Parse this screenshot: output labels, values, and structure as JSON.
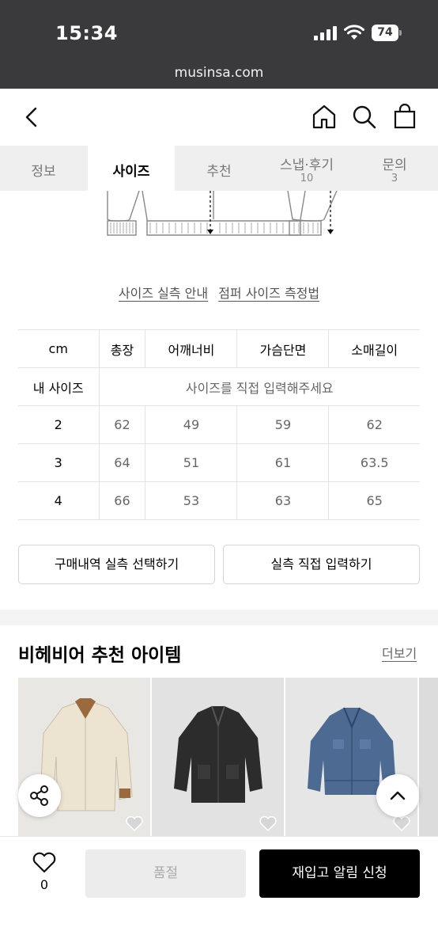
{
  "status_bar": {
    "time": "15:34",
    "battery": "74"
  },
  "browser": {
    "url": "musinsa.com"
  },
  "tabs": [
    {
      "label": "정보",
      "count": ""
    },
    {
      "label": "사이즈",
      "count": ""
    },
    {
      "label": "추천",
      "count": ""
    },
    {
      "label": "스냅·후기",
      "count": "10"
    },
    {
      "label": "문의",
      "count": "3"
    }
  ],
  "active_tab": "사이즈",
  "size_links": {
    "actual_size_guide": "사이즈 실측 안내",
    "measure_method": "점퍼 사이즈 측정법"
  },
  "size_table": {
    "headers": [
      "cm",
      "총장",
      "어깨너비",
      "가슴단면",
      "소매길이"
    ],
    "my_size_label": "내 사이즈",
    "my_size_placeholder": "사이즈를 직접 입력해주세요",
    "rows": [
      {
        "size": "2",
        "values": [
          "62",
          "49",
          "59",
          "62"
        ]
      },
      {
        "size": "3",
        "values": [
          "64",
          "51",
          "61",
          "63.5"
        ]
      },
      {
        "size": "4",
        "values": [
          "66",
          "53",
          "63",
          "65"
        ]
      }
    ]
  },
  "buttons": {
    "select_purchase_size": "구매내역 실측 선택하기",
    "enter_size": "실측 직접 입력하기"
  },
  "recommendations": {
    "title": "비헤비어 추천 아이템",
    "more": "더보기"
  },
  "bottom_bar": {
    "like_count": "0",
    "sold_out": "품절",
    "restock_alert": "재입고 알림 신청"
  },
  "colors": {
    "status_bar": "#3a3a3c",
    "tab_bg": "#efefef",
    "primary_button": "#000000"
  }
}
